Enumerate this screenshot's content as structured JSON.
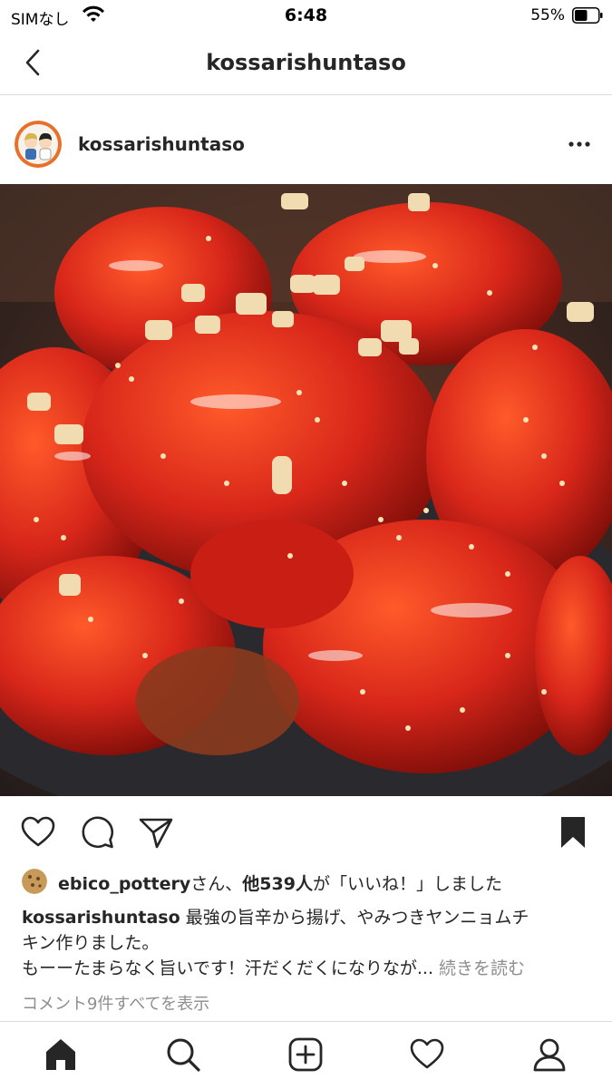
{
  "status_bar": {
    "carrier": "SIMなし",
    "time": "6:48",
    "battery_percent": "55%",
    "battery_level": 0.55,
    "icons": [
      "wifi-icon",
      "battery-icon"
    ]
  },
  "header": {
    "title": "kossarishuntaso",
    "back_icon": "chevron-left-icon"
  },
  "post": {
    "username": "kossarishuntaso",
    "more_icon": "ellipsis-icon",
    "image_subject": "photo",
    "actions": [
      "heart-icon",
      "comment-icon",
      "share-icon",
      "bookmark-icon"
    ],
    "likes": {
      "first_liker": "ebico_pottery",
      "connector": "さん、",
      "others": "他539人",
      "suffix": "が「いいね！」しました"
    },
    "caption": {
      "username": "kossarishuntaso",
      "line1_text": " 最強の旨辛から揚げ、やみつきヤンニョムチ",
      "line2": "キン作りました。",
      "line3": "もーーたまらなく旨いです！汗だくだくになりなが...",
      "more_label": " 続きを読む"
    },
    "view_comments": "コメント9件すべてを表示"
  },
  "tab_bar": {
    "items": [
      "home-icon",
      "search-icon",
      "new-post-icon",
      "activity-icon",
      "profile-icon"
    ]
  },
  "colors": {
    "text": "#262626",
    "secondary": "#8e8e8e",
    "divider": "#dbdbdb",
    "sauce_red": "#d8261a"
  }
}
